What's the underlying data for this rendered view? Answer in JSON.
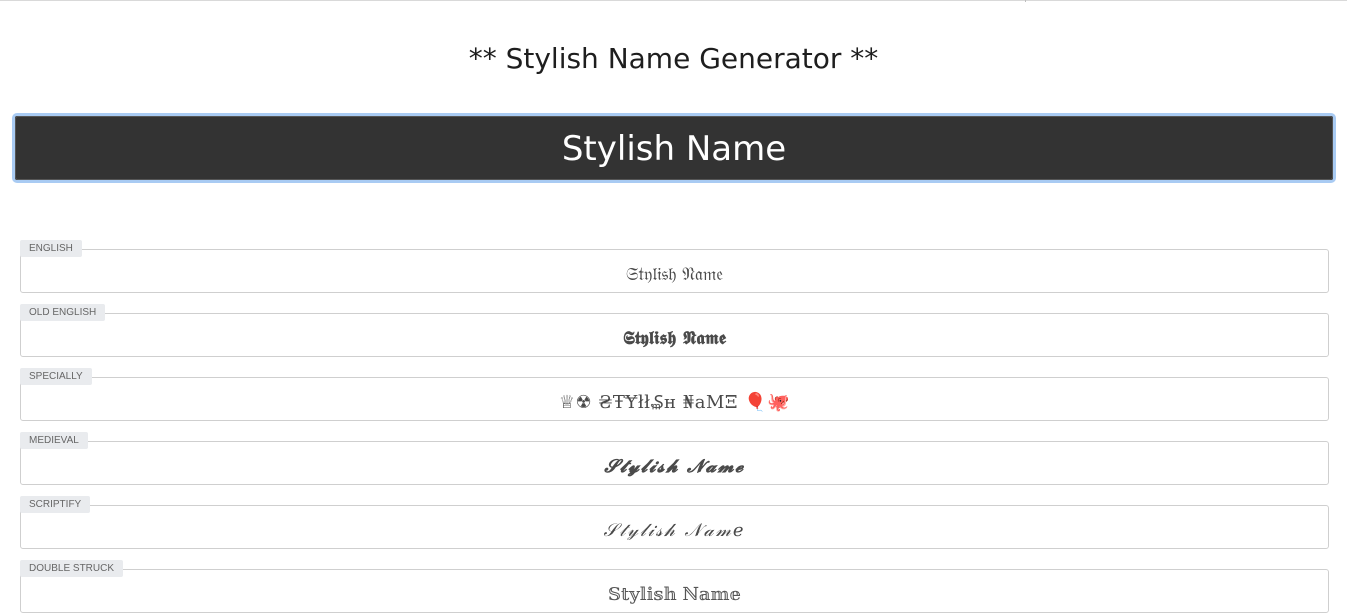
{
  "header": {
    "title": "** Stylish Name Generator **"
  },
  "name_input": {
    "value": "Stylish Name"
  },
  "styles": [
    {
      "label": "ENGLISH",
      "text": "𝔖𝔱𝔶𝔩𝔦𝔰𝔥 𝔑𝔞𝔪𝔢"
    },
    {
      "label": "OLD ENGLISH",
      "text": "𝕾𝖙𝖞𝖑𝖎𝖘𝖍 𝕹𝖆𝖒𝖊"
    },
    {
      "label": "SPECIALLY",
      "text": "♕☢  ₴ŦɎłł₷ʜ ₦aMΞ  🎈🐙"
    },
    {
      "label": "MEDIEVAL",
      "text": "𝓢𝓽𝔂𝓵𝓲𝓼𝓱 𝓝𝓪𝓶𝓮"
    },
    {
      "label": "SCRIPTIFY",
      "text": "𝒮𝓉𝓎𝓁𝒾𝓈𝒽 𝒩𝒶𝓂𝑒"
    },
    {
      "label": "DOUBLE STRUCK",
      "text": "𝕊𝕥𝕪𝕝𝕚𝕤𝕙 ℕ𝕒𝕞𝕖"
    }
  ]
}
